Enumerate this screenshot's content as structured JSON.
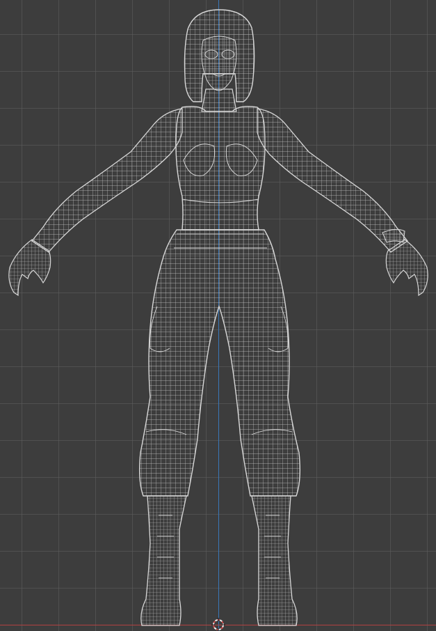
{
  "viewport": {
    "view": "front-orthographic",
    "display_mode": "wireframe",
    "object": "character-mesh",
    "colors": {
      "background": "#3d3d3d",
      "grid": "#5a5a5a",
      "wire": "#c8c8c8",
      "axis_z": "#3a77b8",
      "axis_x": "#b34141",
      "cursor_ring_red": "#d44a4a",
      "cursor_ring_white": "#f0f0f0"
    },
    "icons": {
      "cursor": "3d-cursor-icon"
    }
  }
}
